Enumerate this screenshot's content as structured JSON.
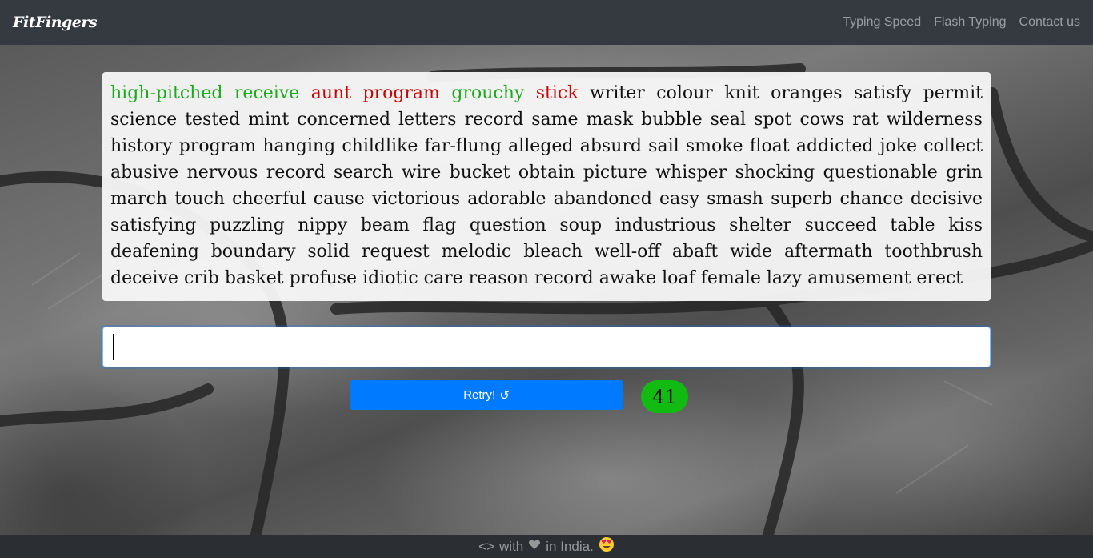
{
  "navbar": {
    "brand": "FitFingers",
    "links": [
      "Typing Speed",
      "Flash Typing",
      "Contact us"
    ]
  },
  "passage": {
    "words": [
      {
        "t": "high-pitched",
        "s": "correct"
      },
      {
        "t": "receive",
        "s": "correct"
      },
      {
        "t": "aunt",
        "s": "wrong"
      },
      {
        "t": "program",
        "s": "wrong"
      },
      {
        "t": "grouchy",
        "s": "correct"
      },
      {
        "t": "stick",
        "s": "wrong"
      },
      {
        "t": "writer",
        "s": "pending"
      },
      {
        "t": "colour",
        "s": "pending"
      },
      {
        "t": "knit",
        "s": "pending"
      },
      {
        "t": "oranges",
        "s": "pending"
      },
      {
        "t": "satisfy",
        "s": "pending"
      },
      {
        "t": "permit",
        "s": "pending"
      },
      {
        "t": "science",
        "s": "pending"
      },
      {
        "t": "tested",
        "s": "pending"
      },
      {
        "t": "mint",
        "s": "pending"
      },
      {
        "t": "concerned",
        "s": "pending"
      },
      {
        "t": "letters",
        "s": "pending"
      },
      {
        "t": "record",
        "s": "pending"
      },
      {
        "t": "same",
        "s": "pending"
      },
      {
        "t": "mask",
        "s": "pending"
      },
      {
        "t": "bubble",
        "s": "pending"
      },
      {
        "t": "seal",
        "s": "pending"
      },
      {
        "t": "spot",
        "s": "pending"
      },
      {
        "t": "cows",
        "s": "pending"
      },
      {
        "t": "rat",
        "s": "pending"
      },
      {
        "t": "wilderness",
        "s": "pending"
      },
      {
        "t": "history",
        "s": "pending"
      },
      {
        "t": "program",
        "s": "pending"
      },
      {
        "t": "hanging",
        "s": "pending"
      },
      {
        "t": "childlike",
        "s": "pending"
      },
      {
        "t": "far-flung",
        "s": "pending"
      },
      {
        "t": "alleged",
        "s": "pending"
      },
      {
        "t": "absurd",
        "s": "pending"
      },
      {
        "t": "sail",
        "s": "pending"
      },
      {
        "t": "smoke",
        "s": "pending"
      },
      {
        "t": "float",
        "s": "pending"
      },
      {
        "t": "addicted",
        "s": "pending"
      },
      {
        "t": "joke",
        "s": "pending"
      },
      {
        "t": "collect",
        "s": "pending"
      },
      {
        "t": "abusive",
        "s": "pending"
      },
      {
        "t": "nervous",
        "s": "pending"
      },
      {
        "t": "record",
        "s": "pending"
      },
      {
        "t": "search",
        "s": "pending"
      },
      {
        "t": "wire",
        "s": "pending"
      },
      {
        "t": "bucket",
        "s": "pending"
      },
      {
        "t": "obtain",
        "s": "pending"
      },
      {
        "t": "picture",
        "s": "pending"
      },
      {
        "t": "whisper",
        "s": "pending"
      },
      {
        "t": "shocking",
        "s": "pending"
      },
      {
        "t": "questionable",
        "s": "pending"
      },
      {
        "t": "grin",
        "s": "pending"
      },
      {
        "t": "march",
        "s": "pending"
      },
      {
        "t": "touch",
        "s": "pending"
      },
      {
        "t": "cheerful",
        "s": "pending"
      },
      {
        "t": "cause",
        "s": "pending"
      },
      {
        "t": "victorious",
        "s": "pending"
      },
      {
        "t": "adorable",
        "s": "pending"
      },
      {
        "t": "abandoned",
        "s": "pending"
      },
      {
        "t": "easy",
        "s": "pending"
      },
      {
        "t": "smash",
        "s": "pending"
      },
      {
        "t": "superb",
        "s": "pending"
      },
      {
        "t": "chance",
        "s": "pending"
      },
      {
        "t": "decisive",
        "s": "pending"
      },
      {
        "t": "satisfying",
        "s": "pending"
      },
      {
        "t": "puzzling",
        "s": "pending"
      },
      {
        "t": "nippy",
        "s": "pending"
      },
      {
        "t": "beam",
        "s": "pending"
      },
      {
        "t": "flag",
        "s": "pending"
      },
      {
        "t": "question",
        "s": "pending"
      },
      {
        "t": "soup",
        "s": "pending"
      },
      {
        "t": "industrious",
        "s": "pending"
      },
      {
        "t": "shelter",
        "s": "pending"
      },
      {
        "t": "succeed",
        "s": "pending"
      },
      {
        "t": "table",
        "s": "pending"
      },
      {
        "t": "kiss",
        "s": "pending"
      },
      {
        "t": "deafening",
        "s": "pending"
      },
      {
        "t": "boundary",
        "s": "pending"
      },
      {
        "t": "solid",
        "s": "pending"
      },
      {
        "t": "request",
        "s": "pending"
      },
      {
        "t": "melodic",
        "s": "pending"
      },
      {
        "t": "bleach",
        "s": "pending"
      },
      {
        "t": "well-off",
        "s": "pending"
      },
      {
        "t": "abaft",
        "s": "pending"
      },
      {
        "t": "wide",
        "s": "pending"
      },
      {
        "t": "aftermath",
        "s": "pending"
      },
      {
        "t": "toothbrush",
        "s": "pending"
      },
      {
        "t": "deceive",
        "s": "pending"
      },
      {
        "t": "crib",
        "s": "pending"
      },
      {
        "t": "basket",
        "s": "pending"
      },
      {
        "t": "profuse",
        "s": "pending"
      },
      {
        "t": "idiotic",
        "s": "pending"
      },
      {
        "t": "care",
        "s": "pending"
      },
      {
        "t": "reason",
        "s": "pending"
      },
      {
        "t": "record",
        "s": "pending"
      },
      {
        "t": "awake",
        "s": "pending"
      },
      {
        "t": "loaf",
        "s": "pending"
      },
      {
        "t": "female",
        "s": "pending"
      },
      {
        "t": "lazy",
        "s": "pending"
      },
      {
        "t": "amusement",
        "s": "pending"
      },
      {
        "t": "erect",
        "s": "pending"
      }
    ]
  },
  "input": {
    "value": "",
    "placeholder": ""
  },
  "retry": {
    "label": "Retry!",
    "icon": "↺"
  },
  "timer": {
    "value": "41"
  },
  "footer": {
    "code": "<>",
    "with": "with",
    "heart_icon": "heart-icon",
    "location": "in India.",
    "emoji_icon": "heart-eyes-emoji-icon"
  },
  "colors": {
    "navbar": "#343a40",
    "correct": "#1aaa1a",
    "wrong": "#cc0000",
    "button": "#007bff",
    "timer": "#11bb11"
  }
}
